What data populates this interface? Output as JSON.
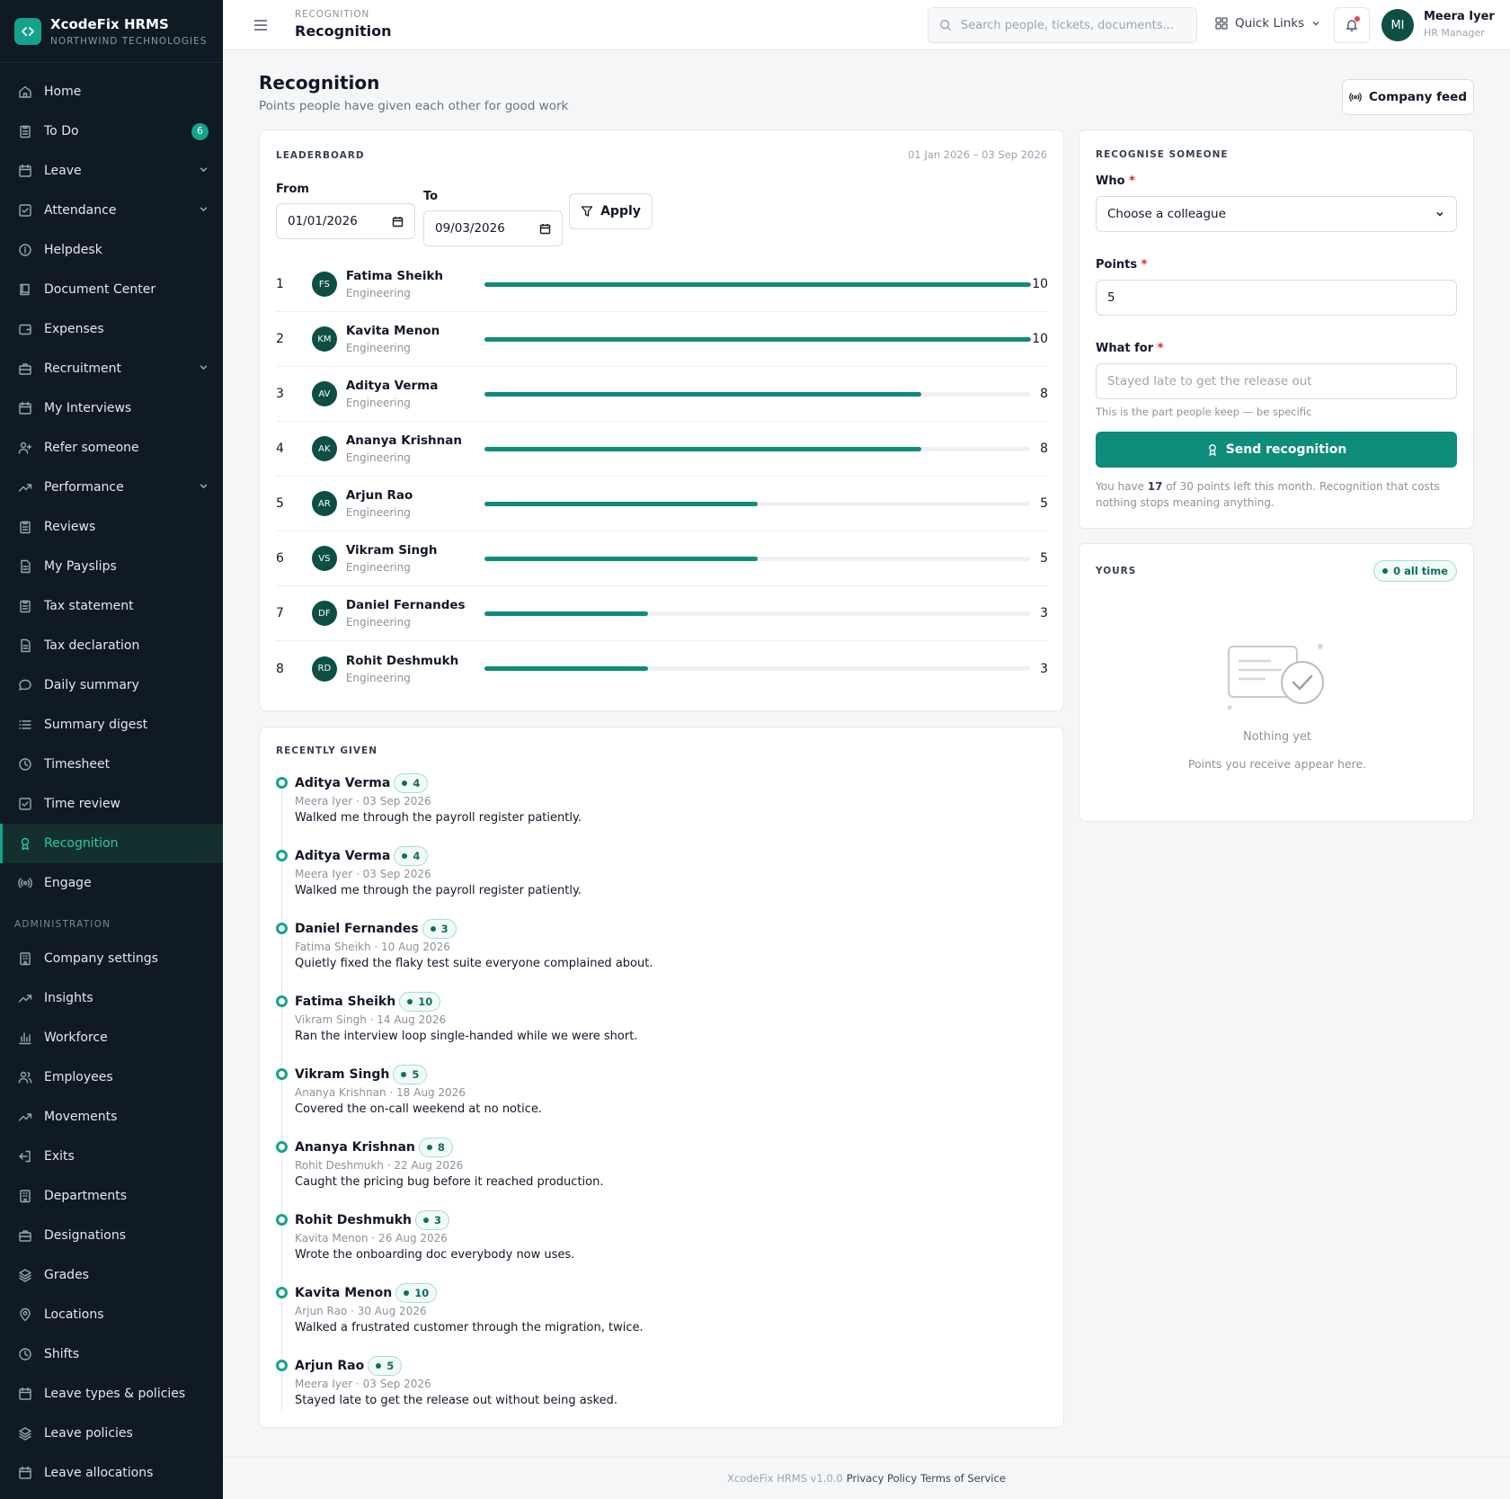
{
  "brand": {
    "name": "XcodeFix HRMS",
    "company": "NORTHWIND TECHNOLOGIES",
    "accent": "#13a38d"
  },
  "sidebar": {
    "items": [
      {
        "label": "Home",
        "icon": "home-icon"
      },
      {
        "label": "To Do",
        "icon": "clipboard-icon",
        "badge": "6"
      },
      {
        "label": "Leave",
        "icon": "calendar-icon",
        "expandable": true
      },
      {
        "label": "Attendance",
        "icon": "check-square-icon",
        "expandable": true
      },
      {
        "label": "Helpdesk",
        "icon": "info-icon"
      },
      {
        "label": "Document Center",
        "icon": "book-icon"
      },
      {
        "label": "Expenses",
        "icon": "wallet-icon"
      },
      {
        "label": "Recruitment",
        "icon": "briefcase-icon",
        "expandable": true
      },
      {
        "label": "My Interviews",
        "icon": "calendar-icon"
      },
      {
        "label": "Refer someone",
        "icon": "user-plus-icon"
      },
      {
        "label": "Performance",
        "icon": "trend-icon",
        "expandable": true
      },
      {
        "label": "Reviews",
        "icon": "clipboard-icon"
      },
      {
        "label": "My Payslips",
        "icon": "file-icon"
      },
      {
        "label": "Tax statement",
        "icon": "clipboard-icon"
      },
      {
        "label": "Tax declaration",
        "icon": "file-icon"
      },
      {
        "label": "Daily summary",
        "icon": "chat-icon"
      },
      {
        "label": "Summary digest",
        "icon": "list-icon"
      },
      {
        "label": "Timesheet",
        "icon": "clock-icon"
      },
      {
        "label": "Time review",
        "icon": "check-square-icon"
      },
      {
        "label": "Recognition",
        "icon": "award-icon",
        "active": true
      },
      {
        "label": "Engage",
        "icon": "broadcast-icon"
      }
    ],
    "admin_heading": "ADMINISTRATION",
    "admin_items": [
      {
        "label": "Company settings",
        "icon": "building-icon"
      },
      {
        "label": "Insights",
        "icon": "trend-icon"
      },
      {
        "label": "Workforce",
        "icon": "bar-chart-icon"
      },
      {
        "label": "Employees",
        "icon": "users-icon"
      },
      {
        "label": "Movements",
        "icon": "trend-icon"
      },
      {
        "label": "Exits",
        "icon": "logout-icon"
      },
      {
        "label": "Departments",
        "icon": "building-icon"
      },
      {
        "label": "Designations",
        "icon": "briefcase-icon"
      },
      {
        "label": "Grades",
        "icon": "layers-icon"
      },
      {
        "label": "Locations",
        "icon": "pin-icon"
      },
      {
        "label": "Shifts",
        "icon": "clock-icon"
      },
      {
        "label": "Leave types & policies",
        "icon": "calendar-icon"
      },
      {
        "label": "Leave policies",
        "icon": "layers-icon"
      },
      {
        "label": "Leave allocations",
        "icon": "calendar-icon"
      }
    ]
  },
  "topbar": {
    "breadcrumb": "RECOGNITION",
    "title": "Recognition",
    "search_placeholder": "Search people, tickets, documents...",
    "quick_links": "Quick Links",
    "user": {
      "initials": "MI",
      "name": "Meera Iyer",
      "role": "HR Manager"
    }
  },
  "header": {
    "title": "Recognition",
    "subtitle": "Points people have given each other for good work",
    "feed_button": "Company feed"
  },
  "leaderboard": {
    "label": "LEADERBOARD",
    "range": "01 Jan 2026 – 03 Sep 2026",
    "from_label": "From",
    "from_value": "01/01/2026",
    "to_label": "To",
    "to_value": "09/03/2026",
    "apply_label": "Apply",
    "max_points": 10,
    "rows": [
      {
        "rank": "1",
        "initials": "FS",
        "name": "Fatima Sheikh",
        "dept": "Engineering",
        "points": 10
      },
      {
        "rank": "2",
        "initials": "KM",
        "name": "Kavita Menon",
        "dept": "Engineering",
        "points": 10
      },
      {
        "rank": "3",
        "initials": "AV",
        "name": "Aditya Verma",
        "dept": "Engineering",
        "points": 8
      },
      {
        "rank": "4",
        "initials": "AK",
        "name": "Ananya Krishnan",
        "dept": "Engineering",
        "points": 8
      },
      {
        "rank": "5",
        "initials": "AR",
        "name": "Arjun Rao",
        "dept": "Engineering",
        "points": 5
      },
      {
        "rank": "6",
        "initials": "VS",
        "name": "Vikram Singh",
        "dept": "Engineering",
        "points": 5
      },
      {
        "rank": "7",
        "initials": "DF",
        "name": "Daniel Fernandes",
        "dept": "Engineering",
        "points": 3
      },
      {
        "rank": "8",
        "initials": "RD",
        "name": "Rohit Deshmukh",
        "dept": "Engineering",
        "points": 3
      }
    ]
  },
  "recent": {
    "label": "RECENTLY GIVEN",
    "items": [
      {
        "name": "Aditya Verma",
        "points": "4",
        "meta": "Meera Iyer · 03 Sep 2026",
        "text": "Walked me through the payroll register patiently."
      },
      {
        "name": "Aditya Verma",
        "points": "4",
        "meta": "Meera Iyer · 03 Sep 2026",
        "text": "Walked me through the payroll register patiently."
      },
      {
        "name": "Daniel Fernandes",
        "points": "3",
        "meta": "Fatima Sheikh · 10 Aug 2026",
        "text": "Quietly fixed the flaky test suite everyone complained about."
      },
      {
        "name": "Fatima Sheikh",
        "points": "10",
        "meta": "Vikram Singh · 14 Aug 2026",
        "text": "Ran the interview loop single-handed while we were short."
      },
      {
        "name": "Vikram Singh",
        "points": "5",
        "meta": "Ananya Krishnan · 18 Aug 2026",
        "text": "Covered the on-call weekend at no notice."
      },
      {
        "name": "Ananya Krishnan",
        "points": "8",
        "meta": "Rohit Deshmukh · 22 Aug 2026",
        "text": "Caught the pricing bug before it reached production."
      },
      {
        "name": "Rohit Deshmukh",
        "points": "3",
        "meta": "Kavita Menon · 26 Aug 2026",
        "text": "Wrote the onboarding doc everybody now uses."
      },
      {
        "name": "Kavita Menon",
        "points": "10",
        "meta": "Arjun Rao · 30 Aug 2026",
        "text": "Walked a frustrated customer through the migration, twice."
      },
      {
        "name": "Arjun Rao",
        "points": "5",
        "meta": "Meera Iyer · 03 Sep 2026",
        "text": "Stayed late to get the release out without being asked."
      }
    ]
  },
  "recognise": {
    "label": "RECOGNISE SOMEONE",
    "who_label": "Who",
    "who_value": "Choose a colleague",
    "points_label": "Points",
    "points_value": "5",
    "what_label": "What for",
    "what_placeholder": "Stayed late to get the release out",
    "hint": "This is the part people keep — be specific",
    "send_label": "Send recognition",
    "note_prefix": "You have ",
    "note_points": "17",
    "note_suffix": " of 30 points left this month. Recognition that costs nothing stops meaning anything."
  },
  "yours": {
    "label": "YOURS",
    "pill": "0 all time",
    "empty_title": "Nothing yet",
    "empty_sub": "Points you receive appear here."
  },
  "footer": {
    "version": "XcodeFix HRMS v1.0.0",
    "privacy": "Privacy Policy",
    "terms": "Terms of Service"
  }
}
